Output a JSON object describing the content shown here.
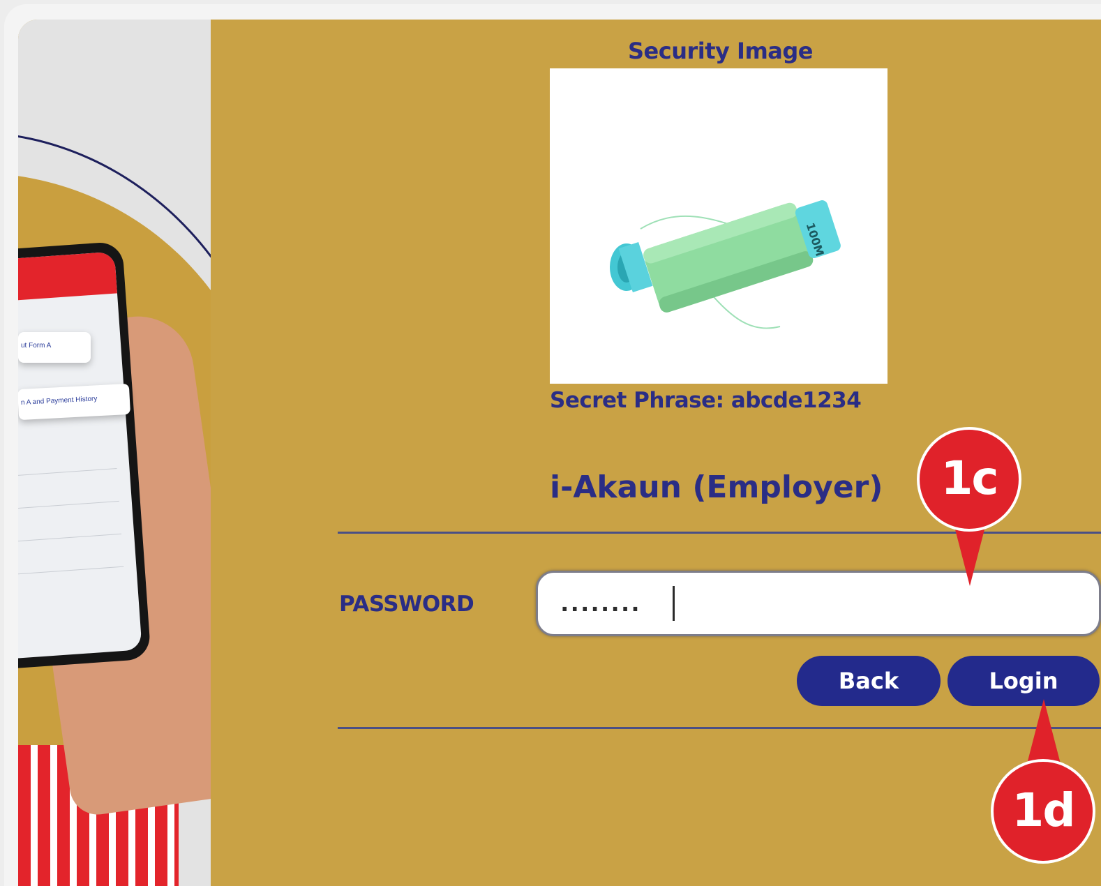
{
  "security": {
    "title": "Security Image",
    "image_icon": "thread-spool-icon",
    "spool_label": "100M",
    "secret_phrase": "Secret Phrase: abcde1234"
  },
  "form": {
    "title": "i-Akaun (Employer)",
    "password_label": "PASSWORD",
    "password_value": "........"
  },
  "buttons": {
    "back": "Back",
    "login": "Login"
  },
  "annotations": {
    "pin_1c": "1c",
    "pin_1d": "1d"
  },
  "promo": {
    "chip_1": "ut Form A",
    "chip_2": "n A and Payment History"
  },
  "colors": {
    "background": "#c9a245",
    "text": "#2a2d85",
    "button": "#232a8c",
    "pin": "#e0222a"
  }
}
